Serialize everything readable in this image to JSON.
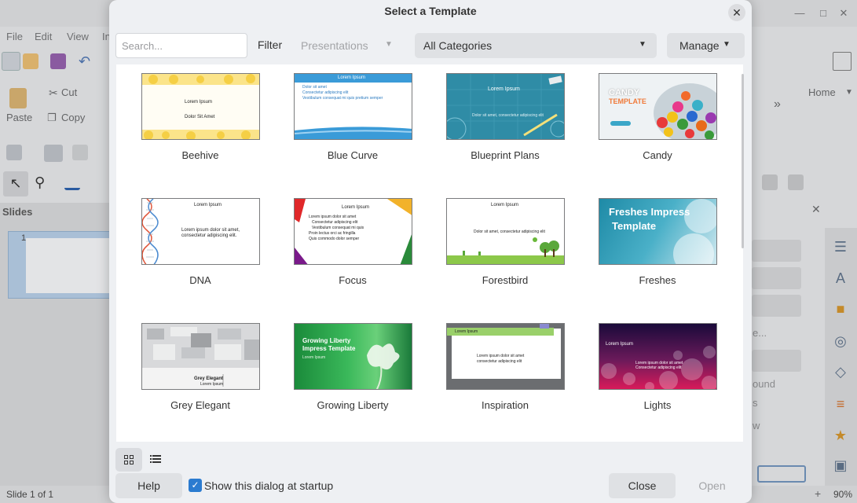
{
  "app": {
    "menu": [
      "File",
      "Edit",
      "View",
      "In"
    ],
    "toolbar": {
      "cut": "Cut",
      "copy": "Copy",
      "paste": "Paste"
    },
    "slides_panel_title": "Slides",
    "slide_number": "1",
    "sidebar_home": "Home",
    "right_panel_texts": [
      "e...",
      "ound",
      "s",
      "w"
    ],
    "status": "Slide 1 of 1",
    "zoom": "90%"
  },
  "dialog": {
    "title": "Select a Template",
    "search_placeholder": "Search...",
    "filter_label": "Filter",
    "filter_type": "Presentations",
    "category": "All Categories",
    "manage_label": "Manage",
    "templates": [
      {
        "name": "Beehive",
        "thumb_lines": [
          "Lorem Ipsum",
          "Dolor Sit Amet"
        ]
      },
      {
        "name": "Blue Curve",
        "thumb_lines": [
          "Lorem Ipsum",
          "Dolor sit amet",
          "Consectetur adipiscing elit",
          "Vestibulum consequat mi quis pretium semper"
        ]
      },
      {
        "name": "Blueprint Plans",
        "thumb_lines": [
          "Lorem Ipsum",
          "Dolor sit amet, consectetur adipiscing elit"
        ]
      },
      {
        "name": "Candy",
        "thumb_lines": [
          "CANDY",
          "TEMPLATE"
        ]
      },
      {
        "name": "DNA",
        "thumb_lines": [
          "Lorem Ipsum",
          "Lorem ipsum dolor sit amet,",
          "consectetur adipiscing elit."
        ]
      },
      {
        "name": "Focus",
        "thumb_lines": [
          "Lorem Ipsum",
          "Lorem ipsum dolor sit amet",
          "Consectetur adipiscing elit",
          "Vestibulum consequat mi quis",
          "Proin lectus orci ac fringilla",
          "Quis commodo dolor semper"
        ]
      },
      {
        "name": "Forestbird",
        "thumb_lines": [
          "Lorem Ipsum",
          "Dolor sit amet, consectetur adipiscing elit"
        ]
      },
      {
        "name": "Freshes",
        "thumb_lines": [
          "Freshes Impress",
          "Template"
        ]
      },
      {
        "name": "Grey Elegant",
        "thumb_lines": [
          "Grey Elegant",
          "Lorem Ipsum"
        ]
      },
      {
        "name": "Growing Liberty",
        "thumb_lines": [
          "Growing Liberty",
          "Impress Template",
          "Lorem Ipsum"
        ]
      },
      {
        "name": "Inspiration",
        "thumb_lines": [
          "Lorem Ipsum",
          "Lorem ipsum dolor sit amet",
          "consectetur adipiscing elit"
        ]
      },
      {
        "name": "Lights",
        "thumb_lines": [
          "Lorem Ipsum",
          "Lorem ipsum dolor sit amet",
          "Consectetur adipiscing elit"
        ]
      }
    ],
    "show_at_startup": "Show this dialog at startup",
    "help": "Help",
    "close": "Close",
    "open": "Open"
  }
}
